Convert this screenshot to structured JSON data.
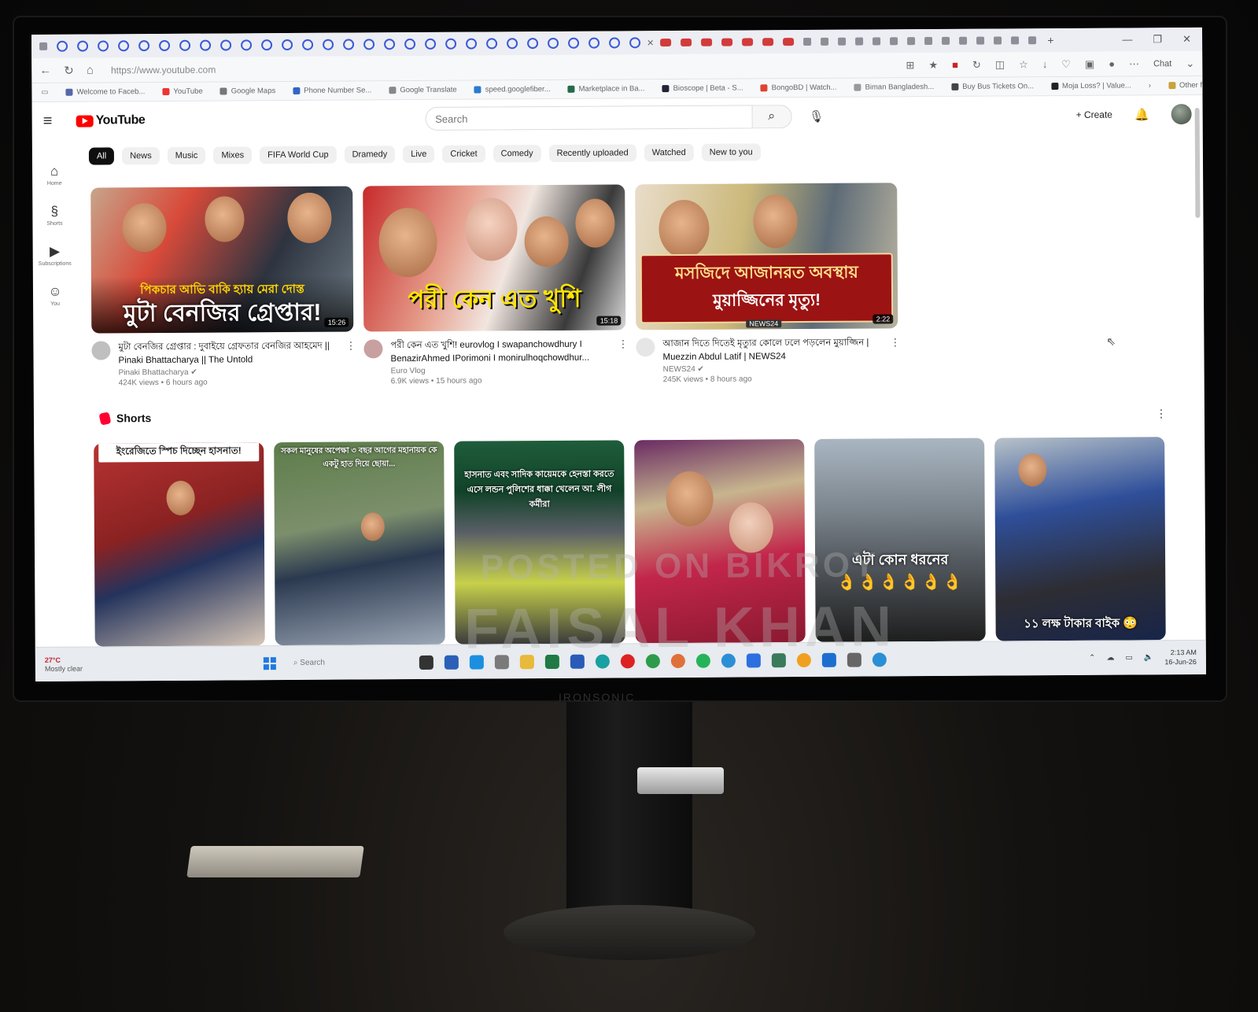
{
  "browser": {
    "url": "https://www.youtube.com",
    "chat_label": "Chat",
    "bookmarks": [
      "Welcome to Faceb...",
      "YouTube",
      "Google Maps",
      "Phone Number Se...",
      "Google Translate",
      "speed.googlefiber...",
      "Marketplace in Ba...",
      "Bioscope | Beta - S...",
      "BongoBD | Watch...",
      "Biman Bangladesh...",
      "Buy Bus Tickets On...",
      "Moja Loss? | Value..."
    ],
    "other_favorites": "Other favorites"
  },
  "youtube": {
    "logo_text": "YouTube",
    "search_placeholder": "Search",
    "create_label": "Create",
    "sidebar": [
      {
        "icon": "home-icon",
        "label": "Home"
      },
      {
        "icon": "shorts-icon",
        "label": "Shorts"
      },
      {
        "icon": "subscriptions-icon",
        "label": "Subscriptions"
      },
      {
        "icon": "you-icon",
        "label": "You"
      }
    ],
    "chips": [
      "All",
      "News",
      "Music",
      "Mixes",
      "FIFA World Cup",
      "Dramedy",
      "Live",
      "Cricket",
      "Comedy",
      "Recently uploaded",
      "Watched",
      "New to you"
    ],
    "active_chip": "All",
    "videos": [
      {
        "thumb_line1": "পিকচার আভি বাকি হ্যায় মেরা দোস্ত",
        "thumb_line2": "মুটা বেনজির গ্রেপ্তার!",
        "duration": "15:26",
        "title": "মুটা বেনজির গ্রেপ্তার : দুবাইয়ে গ্রেফতার বেনজির আহমেদ || Pinaki Bhattacharya || The Untold",
        "channel": "Pinaki Bhattacharya",
        "stats": "424K views • 6 hours ago"
      },
      {
        "thumb_line1": "",
        "thumb_line2": "পরী কেন এত খুশি",
        "duration": "15:18",
        "title": "পরী কেন এত খুশি! eurovlog I swapanchowdhury I BenazirAhmed IPorimoni I monirulhoqchowdhur...",
        "channel": "Euro Vlog",
        "stats": "6.9K views • 15 hours ago"
      },
      {
        "thumb_line1": "মসজিদে আজানরত অবস্থায়",
        "thumb_line2": "মুয়াজ্জিনের মৃত্যু!",
        "duration": "2:22",
        "tag": "NEWS24",
        "title": "আজান দিতে দিতেই মৃত্যুর কোলে ঢলে পড়লেন মুয়াজ্জিন | Muezzin Abdul Latif | NEWS24",
        "channel": "NEWS24",
        "stats": "245K views • 8 hours ago"
      }
    ],
    "shorts_title": "Shorts",
    "shorts": [
      {
        "caption": "ইংরেজিতে স্পিচ দিচ্ছেন হাসনাত!"
      },
      {
        "caption": "সকল মানুষের অপেক্ষা ৩ বছর আগের মহানায়ক কে একটু হাত দিয়ে ছোয়া..."
      },
      {
        "caption": "হাসনাত এবং সাদিক কায়েমকে হেনস্তা করতে এসে লন্ডন পুলিশের ধাক্কা খেলেন আ. লীগ কর্মীরা"
      },
      {
        "caption": ""
      },
      {
        "caption": "এটা কোন ধরনের",
        "emoji": "👌👌👌👌👌👌"
      },
      {
        "caption": "১১ লক্ষ টাকার বাইক 😳"
      }
    ]
  },
  "taskbar": {
    "weather_temp": "27°C",
    "weather_desc": "Mostly clear",
    "search": "Search",
    "time": "2:13 AM",
    "date": "16-Jun-26"
  },
  "monitor": {
    "brand": "IRONSONIC"
  },
  "watermark": {
    "line1": "POSTED ON BIKROY",
    "line2": "FAISAL KHAN"
  },
  "colors": {
    "youtube_red": "#ff0000",
    "chip_active_bg": "#0f0f0f",
    "screen_bg": "#ffffff"
  }
}
